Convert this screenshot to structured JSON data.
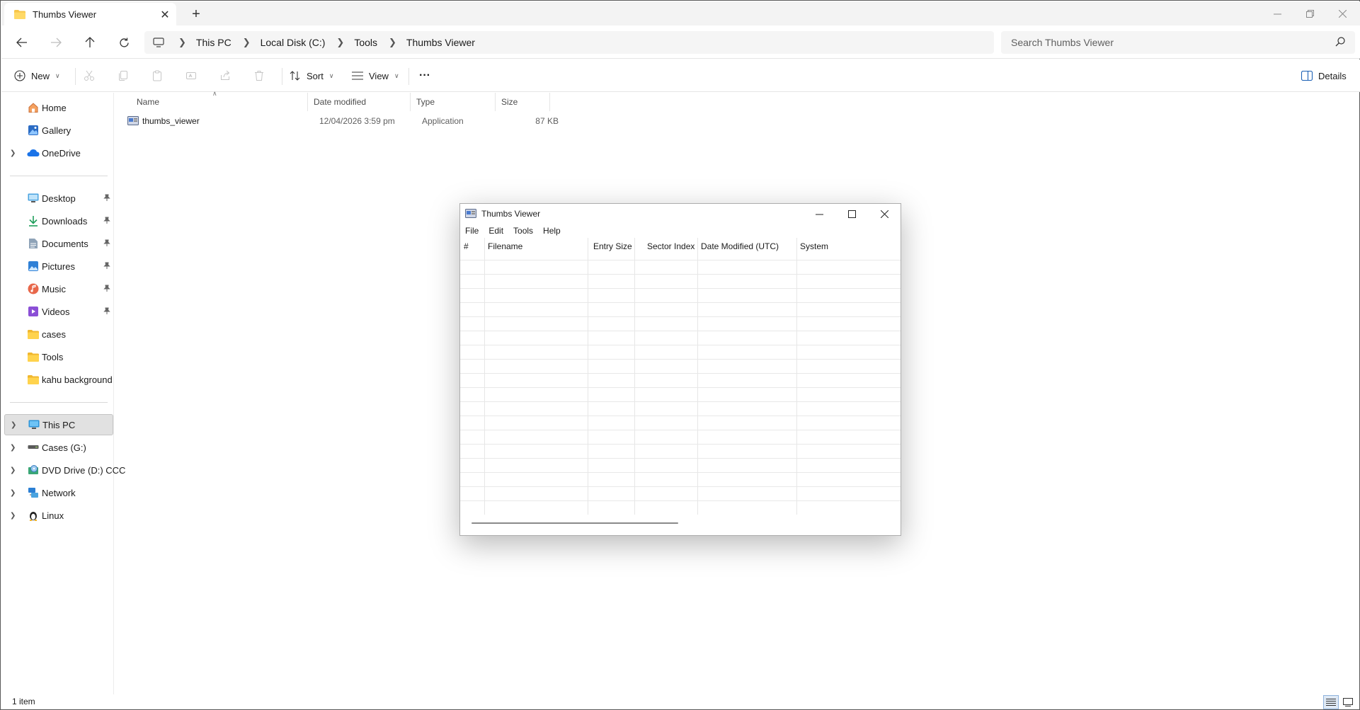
{
  "tab": {
    "title": "Thumbs Viewer",
    "close_label": "✕",
    "new_tab_label": "+"
  },
  "window_controls": {
    "minimize": "—",
    "restore": "❐",
    "close": "✕"
  },
  "breadcrumb": [
    "This PC",
    "Local Disk (C:)",
    "Tools",
    "Thumbs Viewer"
  ],
  "search": {
    "placeholder": "Search Thumbs Viewer"
  },
  "commands": {
    "new_label": "New",
    "sort_label": "Sort",
    "view_label": "View",
    "more_label": "···",
    "details_label": "Details"
  },
  "sidebar": {
    "quick": [
      {
        "label": "Home",
        "icon": "home-icon"
      },
      {
        "label": "Gallery",
        "icon": "gallery-icon"
      },
      {
        "label": "OneDrive",
        "icon": "onedrive-icon"
      }
    ],
    "pinned": [
      {
        "label": "Desktop",
        "icon": "desktop-icon"
      },
      {
        "label": "Downloads",
        "icon": "downloads-icon"
      },
      {
        "label": "Documents",
        "icon": "documents-icon"
      },
      {
        "label": "Pictures",
        "icon": "pictures-icon"
      },
      {
        "label": "Music",
        "icon": "music-icon"
      },
      {
        "label": "Videos",
        "icon": "videos-icon"
      },
      {
        "label": "cases",
        "icon": "folder-icon"
      },
      {
        "label": "Tools",
        "icon": "folder-icon"
      },
      {
        "label": "kahu background",
        "icon": "folder-icon"
      }
    ],
    "drives": [
      {
        "label": "This PC",
        "icon": "this-pc-icon"
      },
      {
        "label": "Cases (G:)",
        "icon": "drive-icon"
      },
      {
        "label": "DVD Drive (D:) CCC",
        "icon": "dvd-icon"
      },
      {
        "label": "Network",
        "icon": "network-icon"
      },
      {
        "label": "Linux",
        "icon": "linux-icon"
      }
    ]
  },
  "file_list": {
    "columns": [
      "Name",
      "Date modified",
      "Type",
      "Size"
    ],
    "rows": [
      {
        "name": "thumbs_viewer",
        "date": "12/04/2026 3:59 pm",
        "type": "Application",
        "size": "87 KB"
      }
    ]
  },
  "status": {
    "item_count": "1 item"
  },
  "app_window": {
    "title": "Thumbs Viewer",
    "menu": [
      "File",
      "Edit",
      "Tools",
      "Help"
    ],
    "columns": [
      "#",
      "Filename",
      "Entry Size",
      "Sector Index",
      "Date Modified (UTC)",
      "System"
    ]
  }
}
